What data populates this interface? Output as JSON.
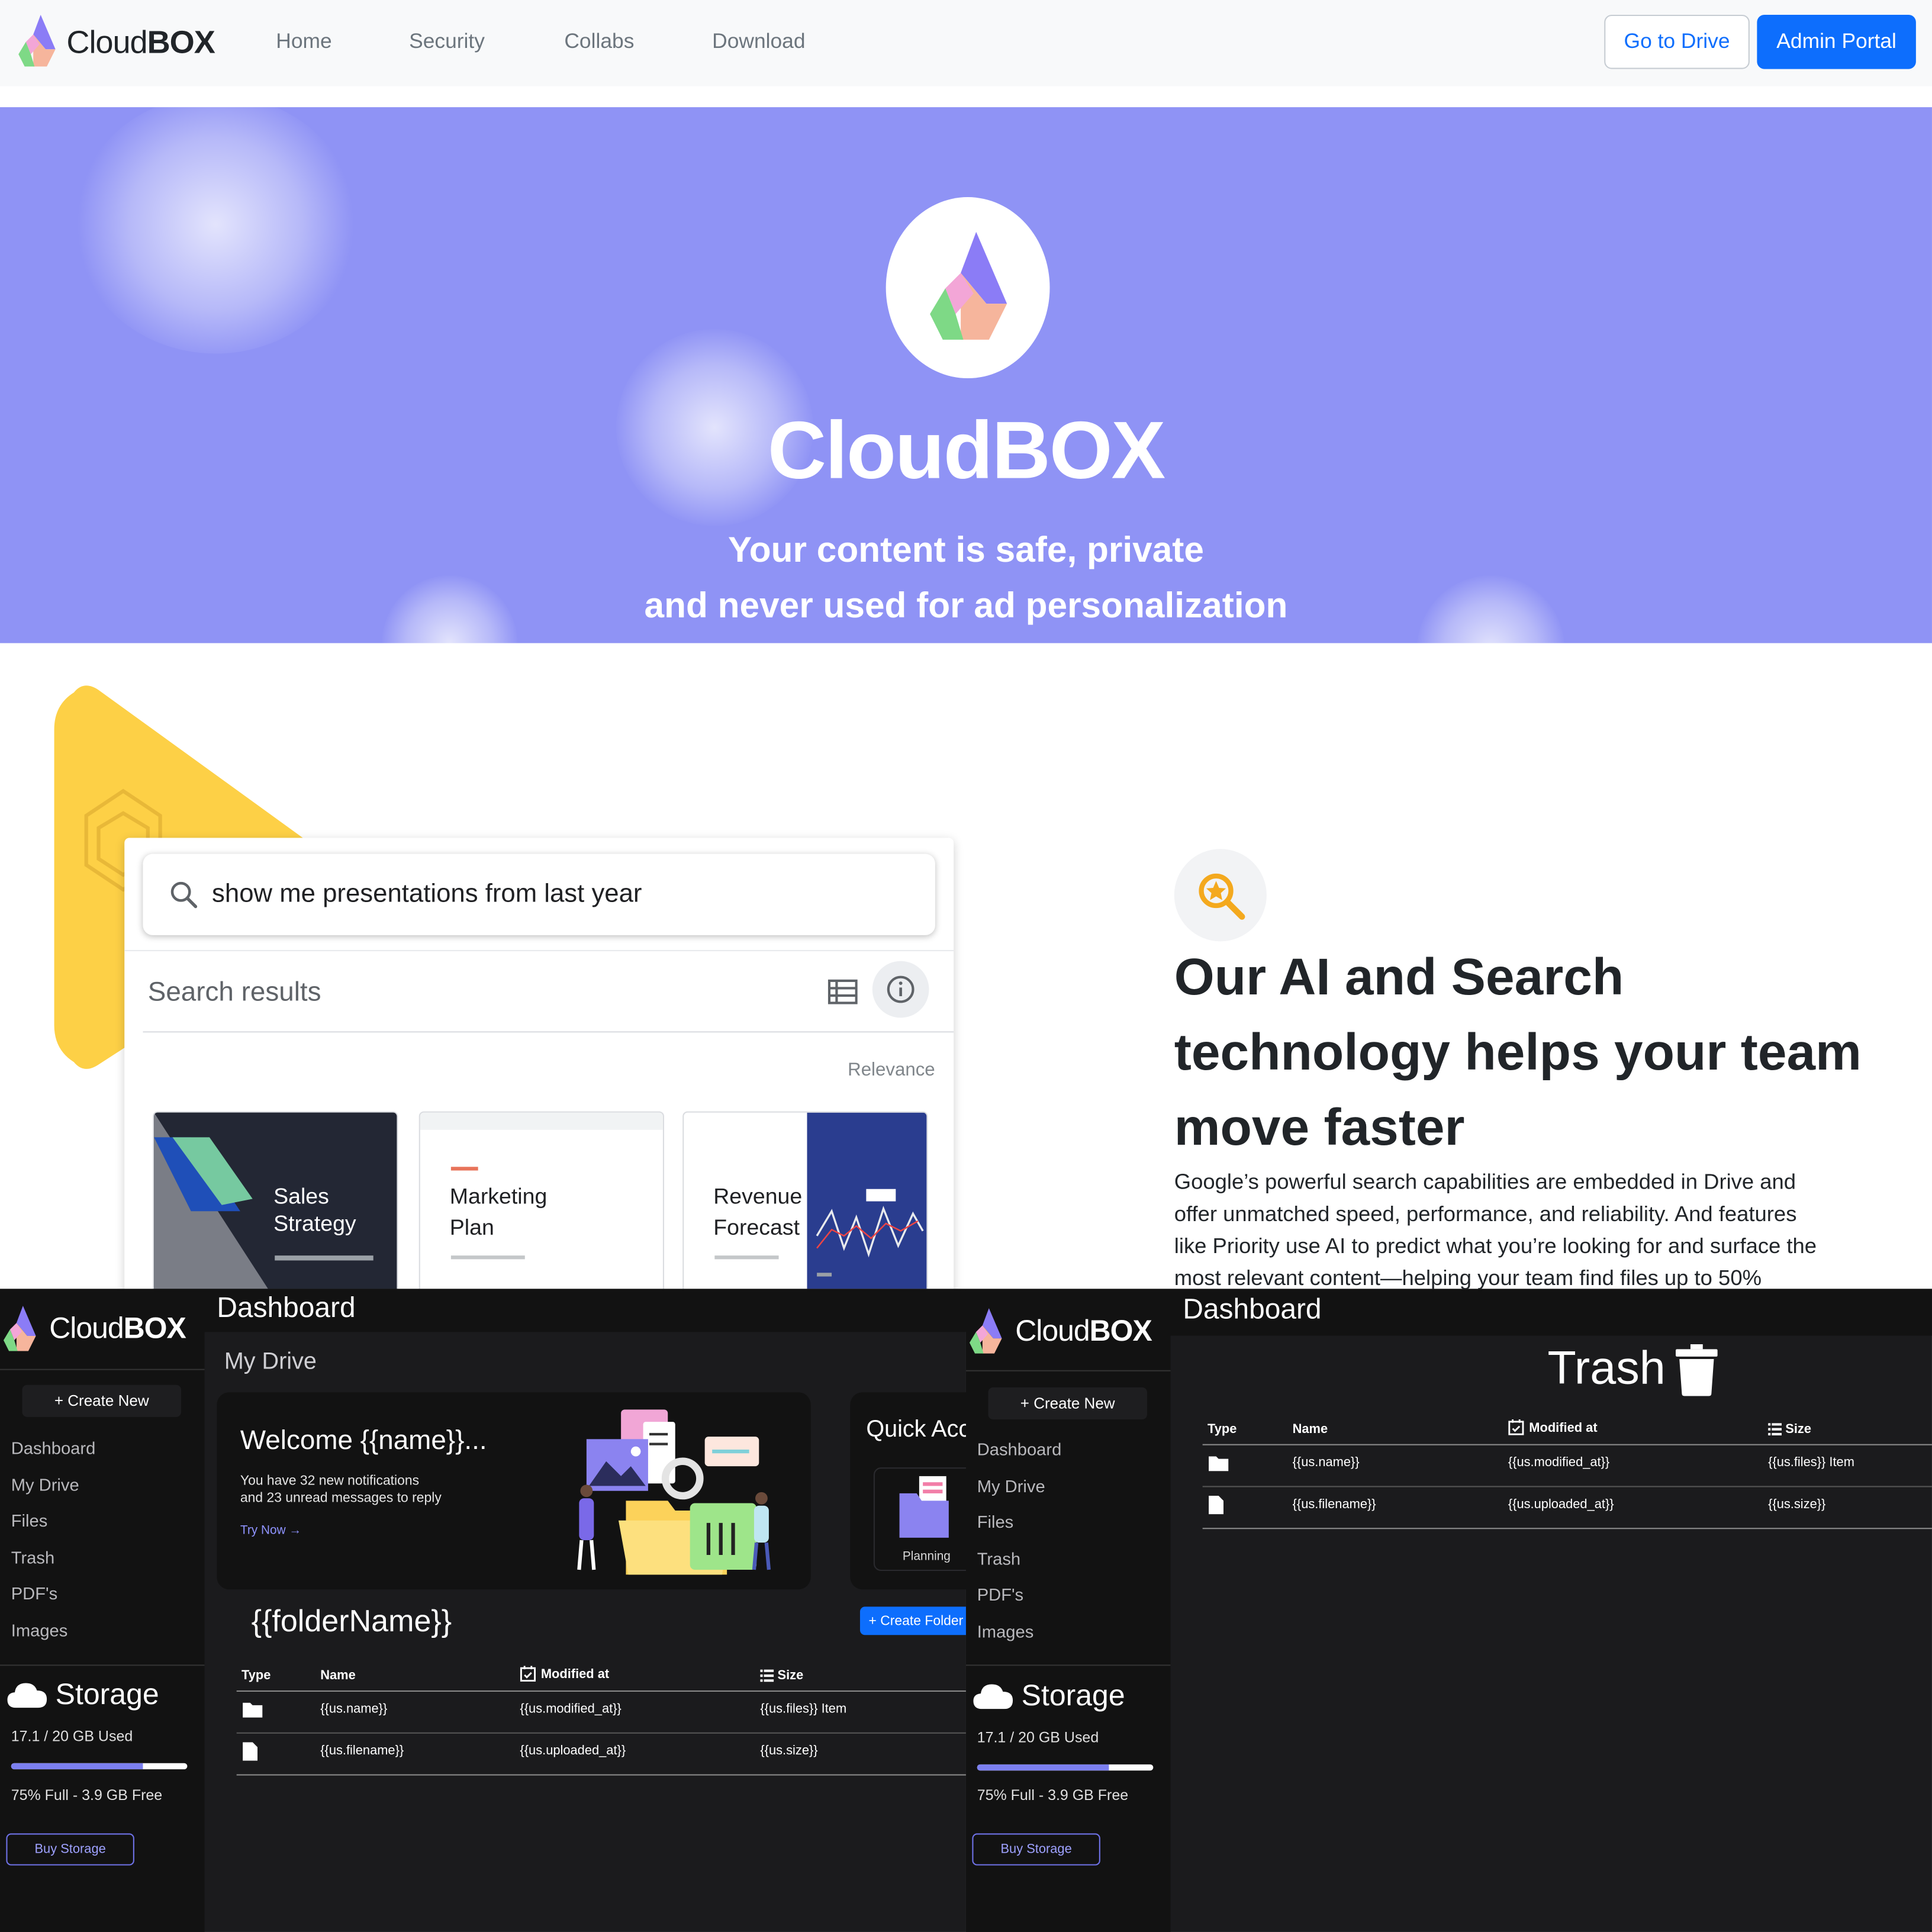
{
  "navbar": {
    "brand_light": "Cloud",
    "brand_bold": "BOX",
    "links": [
      "Home",
      "Security",
      "Collabs",
      "Download"
    ],
    "go_to_drive": "Go to Drive",
    "admin_portal": "Admin Portal"
  },
  "hero": {
    "title": "CloudBOX",
    "subtitle_line1": "Your content is safe, private",
    "subtitle_line2": "and never used for ad personalization",
    "bg_color": "#8f93f5"
  },
  "feature": {
    "search_query": "show me presentations from last year",
    "search_results_label": "Search results",
    "sort_label": "Relevance",
    "cards": [
      {
        "line1": "Sales",
        "line2": "Strategy"
      },
      {
        "line1": "Marketing",
        "line2": "Plan"
      },
      {
        "line1": "Revenue",
        "line2": "Forecast"
      }
    ],
    "title": "Our AI and Search technology helps your team move faster",
    "body": "Google’s powerful search capabilities are embedded in Drive and offer unmatched speed, performance, and reliability. And features like Priority use AI to predict what you’re looking for and surface the most relevant content—helping your team find files up to 50%"
  },
  "dashboard_common": {
    "brand_light": "Cloud",
    "brand_bold": "BOX",
    "topbar_title": "Dashboard",
    "create_new": "+ Create New",
    "nav": [
      "Dashboard",
      "My Drive",
      "Files",
      "Trash",
      "PDF's",
      "Images"
    ],
    "storage_title": "Storage",
    "used": "17.1 / 20 GB Used",
    "used_fraction": 0.75,
    "free": "75% Full - 3.9 GB Free",
    "buy": "Buy Storage"
  },
  "dash1": {
    "section_title": "My Drive",
    "welcome_title": "Welcome {{name}}...",
    "welcome_line1": "You have 32 new notifications",
    "welcome_line2": "and 23 unread messages to reply",
    "try_now": "Try Now →",
    "quick_access": "Quick Access",
    "quick_item": "Planning",
    "folder_name": "{{folderName}}",
    "create_folder": "+ Create Folder"
  },
  "dash2": {
    "trash_title": "Trash"
  },
  "table": {
    "headers": [
      "Type",
      "Name",
      "Modified at",
      "Size"
    ],
    "row1": {
      "name": "{{us.name}}",
      "modified": "{{us.modified_at}}",
      "size": "{{us.files}} Item"
    },
    "row2": {
      "name": "{{us.filename}}",
      "modified": "{{us.uploaded_at}}",
      "size": "{{us.size}}"
    }
  }
}
